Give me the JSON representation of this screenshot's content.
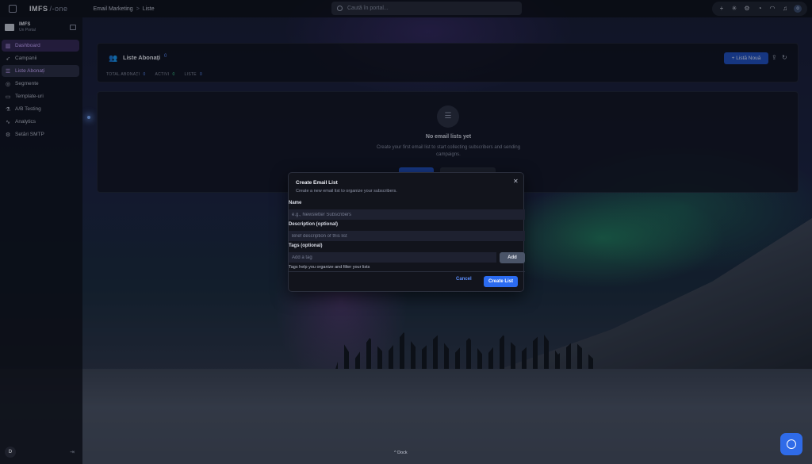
{
  "topbar": {
    "brand": "IMFS",
    "brand_sub": "/-one",
    "breadcrumbs": [
      "Email Marketing",
      "Liste"
    ],
    "search_placeholder": "Caută în portal...",
    "user_initial": "o"
  },
  "sidebar": {
    "org_name": "IMFS",
    "org_sub": "Un Portal",
    "items": [
      {
        "label": "Dashboard",
        "icon": "dashboard-icon"
      },
      {
        "label": "Campanii",
        "icon": "send-icon"
      },
      {
        "label": "Liste Abonați",
        "icon": "list-icon"
      },
      {
        "label": "Segmente",
        "icon": "segment-icon"
      },
      {
        "label": "Template-uri",
        "icon": "template-icon"
      },
      {
        "label": "A/B Testing",
        "icon": "ab-test-icon"
      },
      {
        "label": "Analytics",
        "icon": "analytics-icon"
      },
      {
        "label": "Setări SMTP",
        "icon": "gear-icon"
      }
    ],
    "user_initial": "D"
  },
  "header": {
    "title": "Liste Abonați",
    "badge": "0",
    "new_button": "+ Listă Nouă",
    "stats": [
      {
        "label": "TOTAL ABONAȚI",
        "value": "0"
      },
      {
        "label": "ACTIVI",
        "value": "0"
      },
      {
        "label": "LISTE",
        "value": "0"
      }
    ]
  },
  "empty": {
    "title": "No email lists yet",
    "description": "Create your first email list to start collecting subscribers and sending campaigns."
  },
  "dialog": {
    "title": "Create Email List",
    "subtitle": "Create a new email list to organize your subscribers.",
    "name_label": "Name",
    "name_placeholder": "e.g., Newsletter Subscribers",
    "desc_label": "Description (optional)",
    "desc_placeholder": "Brief description of this list",
    "tags_label": "Tags (optional)",
    "tags_placeholder": "Add a tag",
    "add_button": "Add",
    "tags_hint": "Tags help you organize and filter your lists",
    "cancel_button": "Cancel",
    "create_button": "Create List"
  },
  "dock": {
    "label": "^ Dock"
  },
  "colors": {
    "accent": "#2b6bf0",
    "active_nav": "#c9a8ff",
    "success": "#3ccf8e"
  }
}
